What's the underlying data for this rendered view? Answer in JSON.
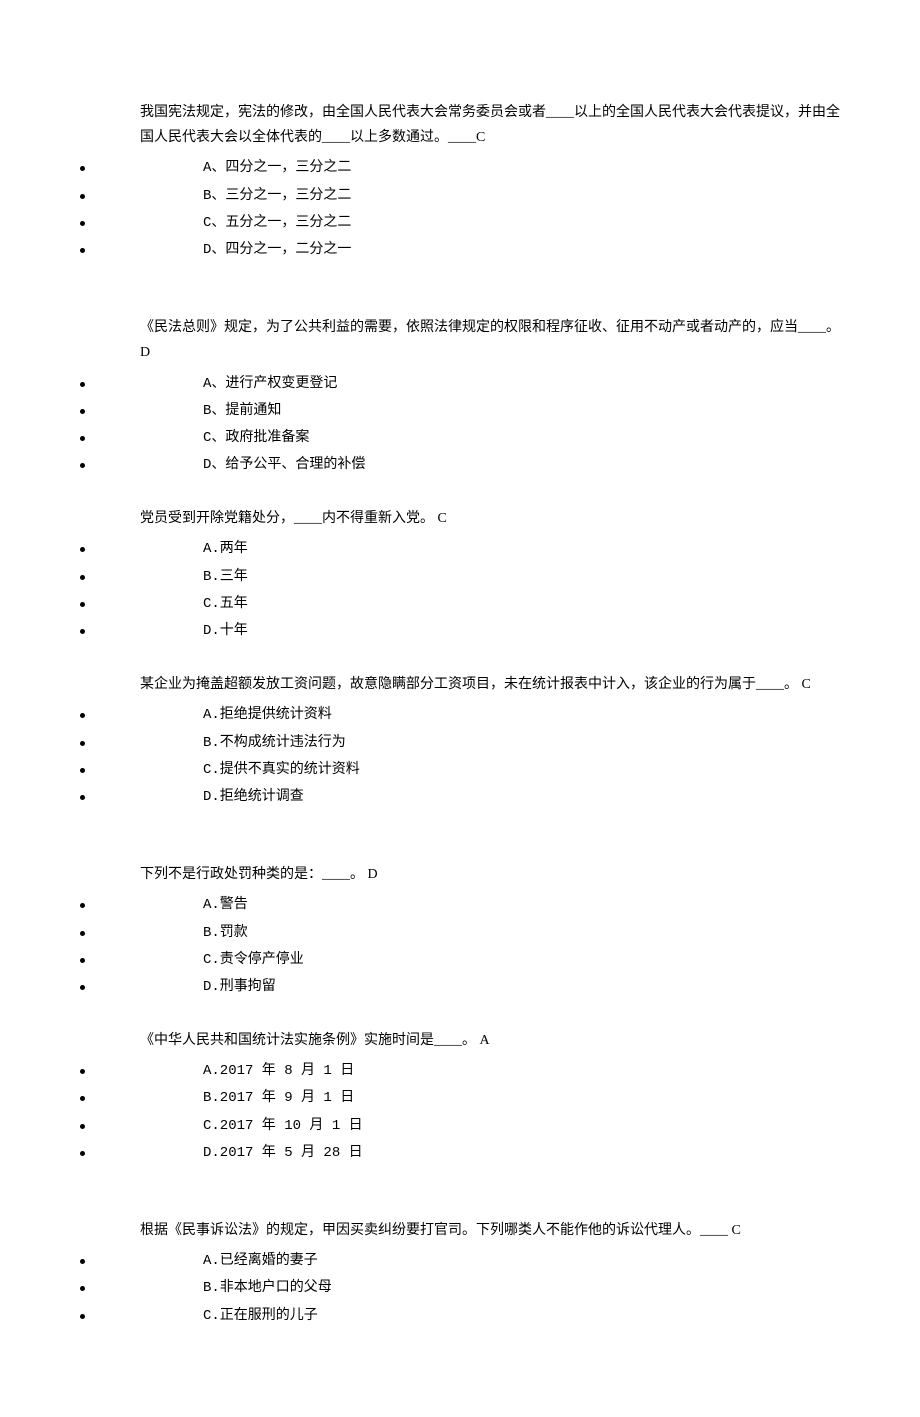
{
  "questions": [
    {
      "text": "我国宪法规定，宪法的修改，由全国人民代表大会常务委员会或者____以上的全国人民代表大会代表提议，并由全国人民代表大会以全体代表的____以上多数通过。____C",
      "options": [
        "A、四分之一，三分之二",
        "B、三分之一，三分之二",
        "C、五分之一，三分之二",
        "D、四分之一，二分之一"
      ],
      "gapAfter": true
    },
    {
      "text": "《民法总则》规定，为了公共利益的需要，依照法律规定的权限和程序征收、征用不动产或者动产的，应当____。  D",
      "options": [
        "A、进行产权变更登记",
        "B、提前通知",
        "C、政府批准备案",
        "D、给予公平、合理的补偿"
      ],
      "gapAfter": false
    },
    {
      "text": "党员受到开除党籍处分，____内不得重新入党。  C",
      "options": [
        "A.两年",
        "B.三年",
        "C.五年",
        "D.十年"
      ],
      "gapAfter": false
    },
    {
      "text": "某企业为掩盖超额发放工资问题，故意隐瞒部分工资项目，未在统计报表中计入，该企业的行为属于____。 C",
      "options": [
        "A.拒绝提供统计资料",
        "B.不构成统计违法行为",
        "C.提供不真实的统计资料",
        "D.拒绝统计调查"
      ],
      "gapAfter": true
    },
    {
      "text": "下列不是行政处罚种类的是：____。 D",
      "options": [
        "A.警告",
        "B.罚款",
        "C.责令停产停业",
        "D.刑事拘留"
      ],
      "gapAfter": false
    },
    {
      "text": "《中华人民共和国统计法实施条例》实施时间是____。 A",
      "options": [
        "A.2017 年 8 月 1 日",
        "B.2017 年 9 月 1 日",
        "C.2017 年 10 月 1 日",
        "D.2017 年 5 月 28 日"
      ],
      "gapAfter": true
    },
    {
      "text": "根据《民事诉讼法》的规定，甲因买卖纠纷要打官司。下列哪类人不能作他的诉讼代理人。____  C",
      "options": [
        "A.已经离婚的妻子",
        "B.非本地户口的父母",
        "C.正在服刑的儿子"
      ],
      "gapAfter": false
    }
  ]
}
